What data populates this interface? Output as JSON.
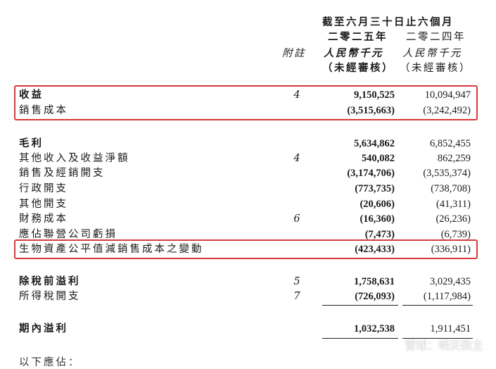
{
  "header": {
    "period": "截至六月三十日止六個月",
    "year_2025": "二零二五年",
    "year_2024": "二零二四年",
    "note_col": "附註",
    "unit_2025": "人民幣千元",
    "unit_2024": "人民幣千元",
    "audit_2025": "（未經審核）",
    "audit_2024": "（未經審核）"
  },
  "rows": [
    {
      "label": "收益",
      "note": "4",
      "v2025": "9,150,525",
      "v2024": "10,094,947"
    },
    {
      "label": "銷售成本",
      "note": "",
      "v2025": "(3,515,663)",
      "v2024": "(3,242,492)"
    },
    {
      "label": "毛利",
      "note": "",
      "v2025": "5,634,862",
      "v2024": "6,852,455"
    },
    {
      "label": "其他收入及收益淨額",
      "note": "4",
      "v2025": "540,082",
      "v2024": "862,259"
    },
    {
      "label": "銷售及經銷開支",
      "note": "",
      "v2025": "(3,174,706)",
      "v2024": "(3,535,374)"
    },
    {
      "label": "行政開支",
      "note": "",
      "v2025": "(773,735)",
      "v2024": "(738,708)"
    },
    {
      "label": "其他開支",
      "note": "",
      "v2025": "(20,606)",
      "v2024": "(41,311)"
    },
    {
      "label": "財務成本",
      "note": "6",
      "v2025": "(16,360)",
      "v2024": "(26,236)"
    },
    {
      "label": "應佔聯營公司虧損",
      "note": "",
      "v2025": "(7,473)",
      "v2024": "(6,739)"
    },
    {
      "label": "生物資產公平值減銷售成本之變動",
      "note": "",
      "v2025": "(423,433)",
      "v2024": "(336,911)"
    },
    {
      "label": "除稅前溢利",
      "note": "5",
      "v2025": "1,758,631",
      "v2024": "3,029,435"
    },
    {
      "label": "所得稅開支",
      "note": "7",
      "v2025": "(726,093)",
      "v2024": "(1,117,984)"
    },
    {
      "label": "期內溢利",
      "note": "",
      "v2025": "1,032,538",
      "v2024": "1,911,451"
    }
  ],
  "partial_text": "以下應佔：",
  "watermark": "雪球：明天教主",
  "colors": {
    "highlight": "#d9393b"
  }
}
